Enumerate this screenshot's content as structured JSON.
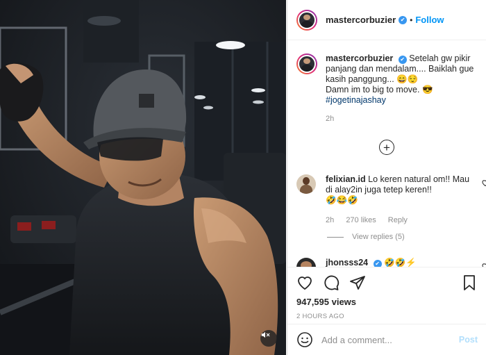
{
  "post": {
    "author": "mastercorbuzier",
    "follow_label": "Follow",
    "separator": "•"
  },
  "caption": {
    "username": "mastercorbuzier",
    "text": "Setelah gw pikir panjang dan mendalam.... Baiklah gue kasih panggung... 😄😌",
    "text2": "Damn im to big to move. 😎",
    "hashtag": "#jogetinajashay",
    "time": "2h"
  },
  "comments": [
    {
      "username": "felixian.id",
      "text": "Lo keren natural om!! Mau di alay2in juga tetep keren!!",
      "emojis": "🤣😂🤣",
      "time": "2h",
      "likes": "270 likes",
      "reply_label": "Reply",
      "view_replies": "View replies (5)"
    },
    {
      "username": "jhonsss24",
      "text": "🤣🤣⚡"
    }
  ],
  "stats": {
    "views": "947,595 views",
    "posted_ago": "2 HOURS AGO"
  },
  "add_comment": {
    "placeholder": "Add a comment...",
    "post_label": "Post"
  },
  "icons": {
    "verified": "verified-badge-icon",
    "heart": "heart-icon",
    "comment": "comment-icon",
    "share": "paper-plane-icon",
    "save": "bookmark-icon",
    "emoji": "emoji-icon",
    "load_more": "plus-circle-icon",
    "mute": "muted-speaker-icon"
  },
  "colors": {
    "accent": "#0095f6",
    "hashtag": "#00376b",
    "verified": "#3897f0",
    "muted_text": "#8e8e8e",
    "post_disabled": "#b2dffc"
  }
}
